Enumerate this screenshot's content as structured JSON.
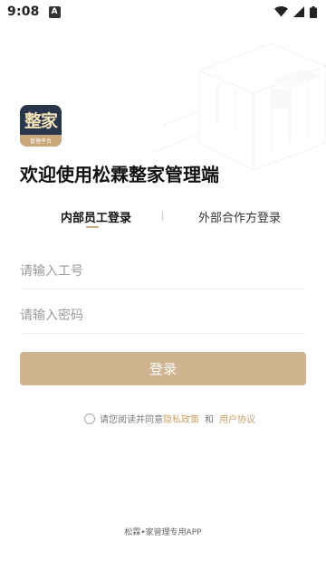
{
  "status_bar": {
    "time": "9:08",
    "notification_icon": "A"
  },
  "logo": {
    "main_text": "整家",
    "sub_text": "管理平台"
  },
  "page_title": "欢迎使用松霖整家管理端",
  "tabs": {
    "internal": "内部员工登录",
    "external": "外部合作方登录",
    "active": "internal"
  },
  "form": {
    "employee_id_placeholder": "请输入工号",
    "password_placeholder": "请输入密码",
    "login_label": "登录"
  },
  "agreement": {
    "prefix": "请您阅读并同意",
    "privacy_label": "隐私政策",
    "conjunction": "和",
    "user_agreement_label": "用户协议"
  },
  "footer": {
    "text": "松霖•家管理专用APP"
  },
  "colors": {
    "accent": "#d0b48f",
    "link": "#c8a06a",
    "logo_bg": "#27364a"
  }
}
